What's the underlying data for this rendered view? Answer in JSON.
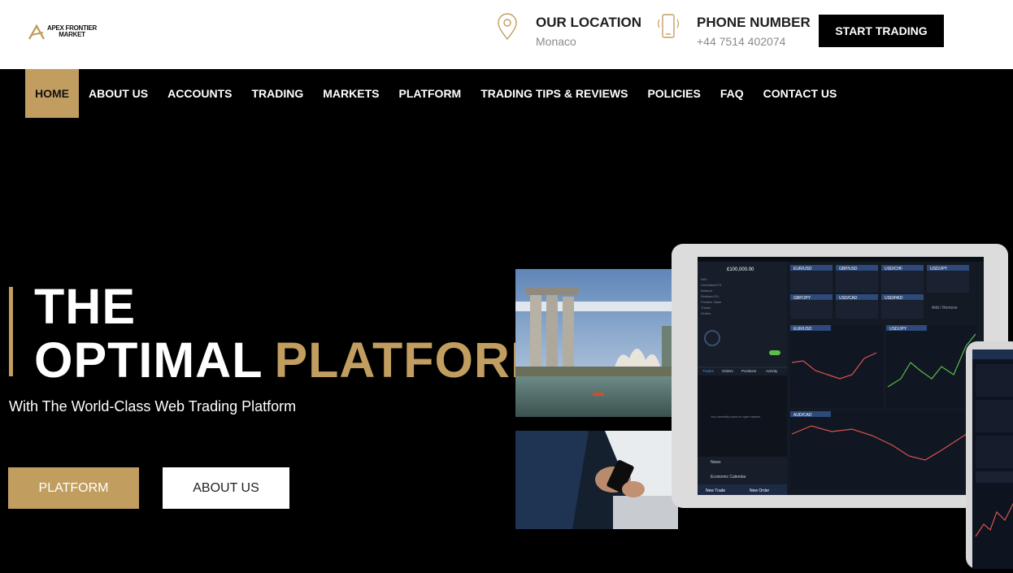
{
  "brand": {
    "line1": "APEX FRONTIER",
    "line2": "MARKET"
  },
  "header": {
    "location_label": "OUR LOCATION",
    "location_value": "Monaco",
    "phone_label": "PHONE NUMBER",
    "phone_value": "+44 7514 402074",
    "cta": "START TRADING"
  },
  "nav": [
    "HOME",
    "ABOUT US",
    "ACCOUNTS",
    "TRADING",
    "MARKETS",
    "PLATFORM",
    "TRADING TIPS & REVIEWS",
    "POLICIES",
    "FAQ",
    "CONTACT US"
  ],
  "hero": {
    "line1": "THE",
    "line2_a": "OPTIMAL",
    "line2_b": "PLATFORM",
    "subtitle": "With The World-Class Web Trading Platform",
    "btn_primary": "PLATFORM",
    "btn_secondary": "ABOUT US"
  },
  "platform": {
    "balance": "£100,000.00",
    "pairs_row1": [
      "EUR/USD",
      "GBP/USD",
      "USD/CHF",
      "USD/JPY"
    ],
    "pairs_row2": [
      "GBP/JPY",
      "USD/CAD",
      "USD/HKD"
    ],
    "add_remove": "Add / Remove",
    "tabs": [
      "Trades",
      "Orders",
      "Positions",
      "Activity"
    ],
    "empty_msg": "You currently have no open trades.",
    "news": "News",
    "calendar": "Economic Calendar",
    "new_trade": "New Trade",
    "new_order": "New Order",
    "chart1": "EUR/USD",
    "chart2": "USD/JPY",
    "chart3": "AUD/CAD"
  },
  "colors": {
    "accent": "#c19e60",
    "dark": "#000000"
  }
}
